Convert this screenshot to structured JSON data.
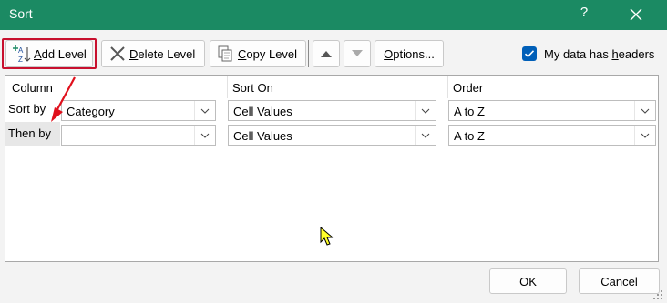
{
  "window": {
    "title": "Sort",
    "help_glyph": "?"
  },
  "toolbar": {
    "add_level_key": "A",
    "add_level_rest": "dd Level",
    "delete_level_key": "D",
    "delete_level_rest": "elete Level",
    "copy_level_key": "C",
    "copy_level_rest": "opy Level",
    "options_key": "O",
    "options_rest": "ptions...",
    "headers_pre": "My data has ",
    "headers_key": "h",
    "headers_post": "eaders",
    "headers_checked": true
  },
  "grid": {
    "columns": [
      "Column",
      "Sort On",
      "Order"
    ],
    "rows": [
      {
        "label": "Sort by",
        "column": "Category",
        "sort_on": "Cell Values",
        "order": "A to Z"
      },
      {
        "label": "Then by",
        "column": "",
        "sort_on": "Cell Values",
        "order": "A to Z"
      }
    ]
  },
  "footer": {
    "ok": "OK",
    "cancel": "Cancel"
  },
  "colors": {
    "titlebar": "#1b8a63",
    "accent": "#005fb8",
    "highlight": "#c8102e",
    "arrow": "#e0101c"
  }
}
